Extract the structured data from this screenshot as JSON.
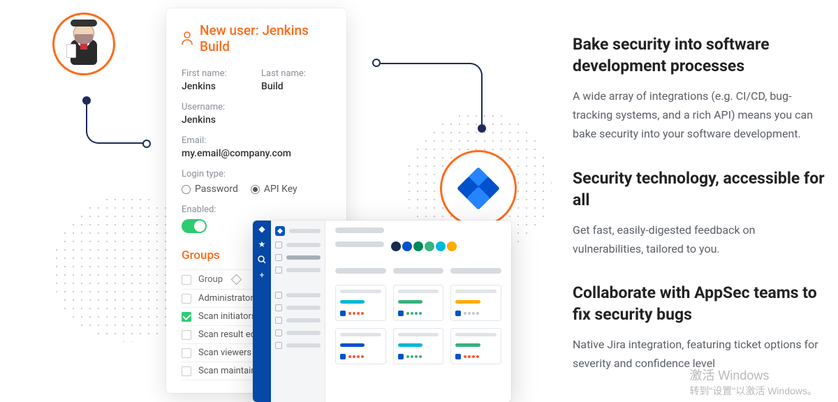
{
  "form": {
    "title": "New user: Jenkins Build",
    "first_name_label": "First name:",
    "first_name": "Jenkins",
    "last_name_label": "Last name:",
    "last_name": "Build",
    "username_label": "Username:",
    "username": "Jenkins",
    "email_label": "Email:",
    "email": "my.email@company.com",
    "login_type_label": "Login type:",
    "login_option_password": "Password",
    "login_option_apikey": "API Key",
    "login_selected": "apikey",
    "enabled_label": "Enabled:",
    "enabled": true,
    "groups_title": "Groups",
    "groups_header": "Group",
    "groups": [
      {
        "label": "Administrators",
        "checked": false
      },
      {
        "label": "Scan initiators",
        "checked": true
      },
      {
        "label": "Scan result editors",
        "checked": false
      },
      {
        "label": "Scan viewers",
        "checked": false
      },
      {
        "label": "Scan maintainers",
        "checked": false
      }
    ]
  },
  "board": {
    "swatches": [
      "#172b4d",
      "#0052cc",
      "#00875a",
      "#36b37e",
      "#00b8d9",
      "#ffab00"
    ],
    "mini_cards": [
      {
        "bar": "#00b8d9",
        "dots": [
          "#ff5630",
          "#ff5630",
          "#ff5630",
          "#ff5630"
        ]
      },
      {
        "bar": "#36b37e",
        "dots": [
          "#36b37e",
          "#36b37e",
          "#36b37e",
          "#36b37e"
        ]
      },
      {
        "bar": "#ffab00",
        "dots": [
          "#c1c7d0",
          "#c1c7d0",
          "#c1c7d0",
          "#c1c7d0"
        ]
      },
      {
        "bar": "#0052cc",
        "dots": [
          "#ff5630",
          "#ff5630",
          "#ff5630",
          "#ff5630"
        ]
      },
      {
        "bar": "#00b8d9",
        "dots": [
          "#36b37e",
          "#36b37e",
          "#36b37e",
          "#36b37e"
        ]
      },
      {
        "bar": "#36b37e",
        "dots": [
          "#ff5630",
          "#ff5630",
          "#ff5630",
          "#ff5630"
        ]
      }
    ]
  },
  "right": {
    "h1": "Bake security into software development processes",
    "p1": "A wide array of integrations (e.g. CI/CD, bug-tracking systems, and a rich API) means you can bake security into your software development.",
    "h2": "Security technology, accessible for all",
    "p2": "Get fast, easily-digested feedback on vulnerabilities, tailored to you.",
    "h3": "Collaborate with AppSec teams to fix security bugs",
    "p3": "Native Jira integration, featuring ticket options for severity and confidence level"
  },
  "watermark": {
    "line1": "激活 Windows",
    "line2": "转到\"设置\"以激活 Windows。"
  }
}
